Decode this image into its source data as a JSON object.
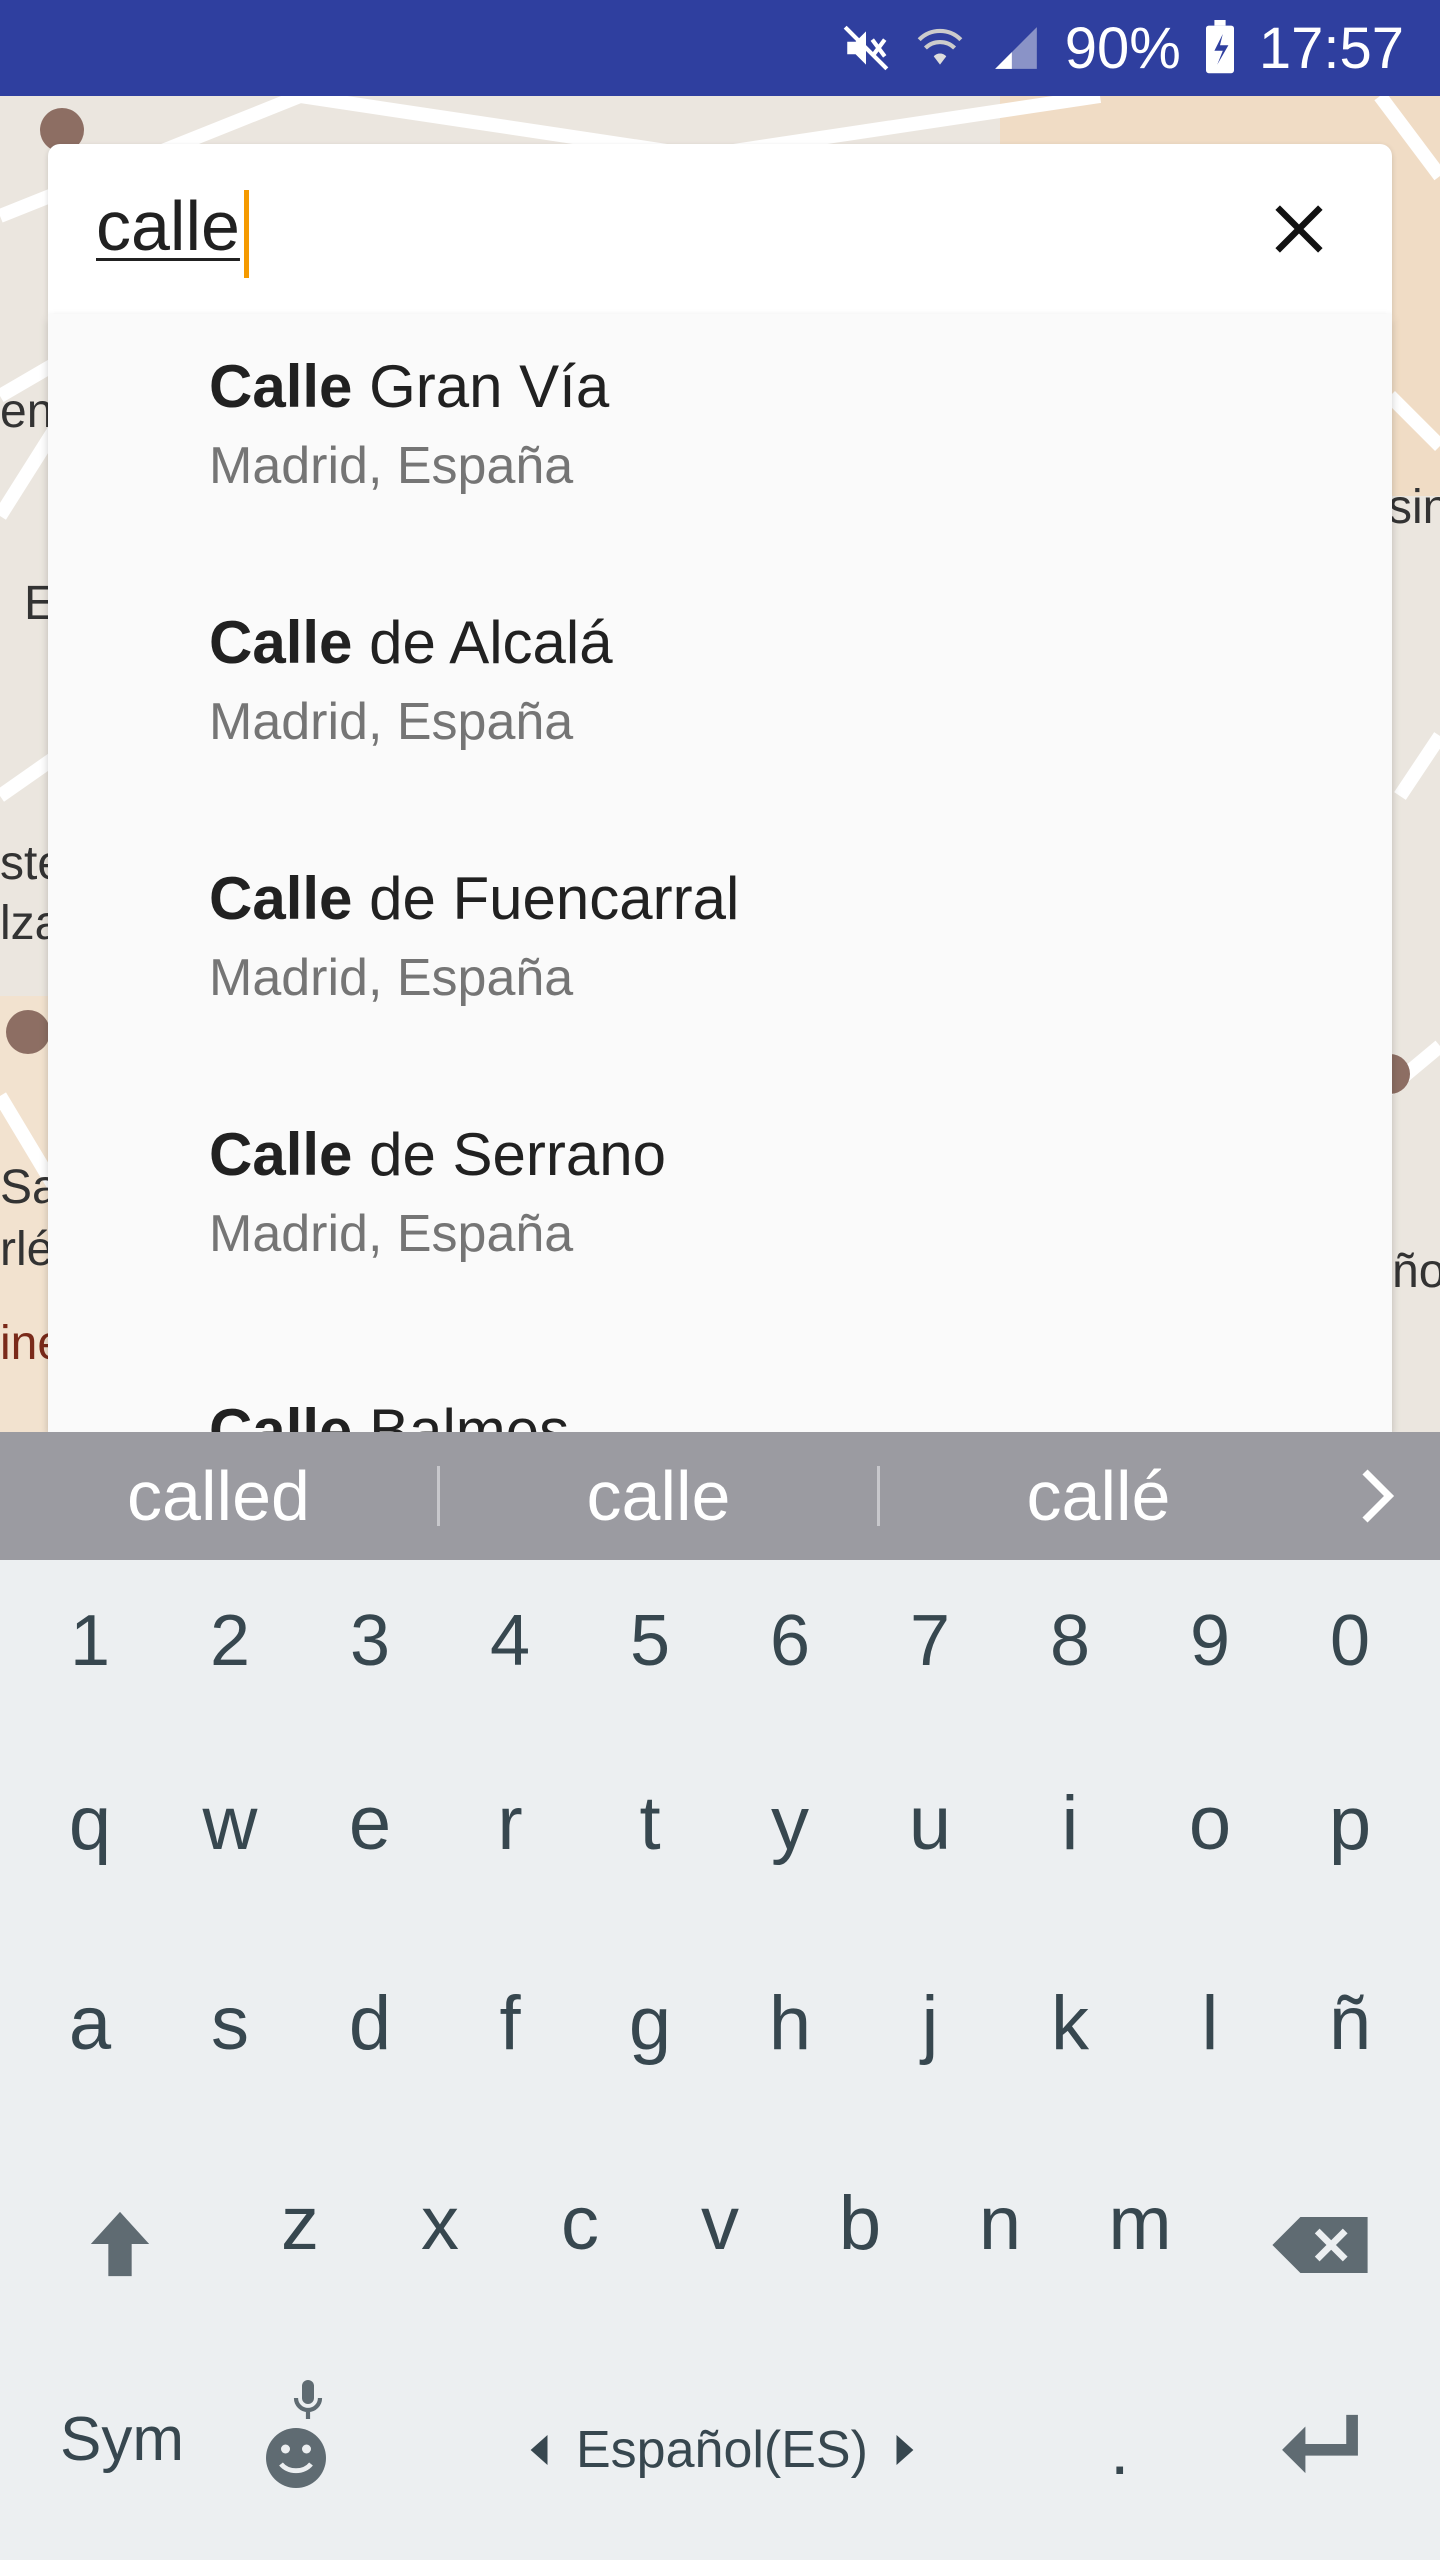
{
  "status_bar": {
    "battery": "90%",
    "time": "17:57",
    "icons": [
      "mute-icon",
      "wifi-icon",
      "signal-icon",
      "battery-charging-icon"
    ]
  },
  "map": {
    "labels": [
      "end",
      "E",
      "ste",
      "lza",
      "Sa",
      "rlé",
      "ine",
      "sin",
      "ño"
    ]
  },
  "search": {
    "value": "calle",
    "clear_icon": "close-icon"
  },
  "suggestions": [
    {
      "bold": "Calle",
      "rest": " Gran Vía",
      "subtitle": "Madrid, España"
    },
    {
      "bold": "Calle",
      "rest": " de Alcalá",
      "subtitle": "Madrid, España"
    },
    {
      "bold": "Calle",
      "rest": " de Fuencarral",
      "subtitle": "Madrid, España"
    },
    {
      "bold": "Calle",
      "rest": " de Serrano",
      "subtitle": "Madrid, España"
    },
    {
      "bold": "Calle",
      "rest": " Balmes",
      "subtitle": ""
    }
  ],
  "predictions": [
    "called",
    "calle",
    "callé"
  ],
  "keyboard": {
    "numbers": [
      "1",
      "2",
      "3",
      "4",
      "5",
      "6",
      "7",
      "8",
      "9",
      "0"
    ],
    "row1": [
      "q",
      "w",
      "e",
      "r",
      "t",
      "y",
      "u",
      "i",
      "o",
      "p"
    ],
    "row2": [
      "a",
      "s",
      "d",
      "f",
      "g",
      "h",
      "j",
      "k",
      "l",
      "ñ"
    ],
    "row3": [
      "z",
      "x",
      "c",
      "v",
      "b",
      "n",
      "m"
    ],
    "sym_label": "Sym",
    "language_label": "Español(ES)",
    "period_label": "."
  }
}
